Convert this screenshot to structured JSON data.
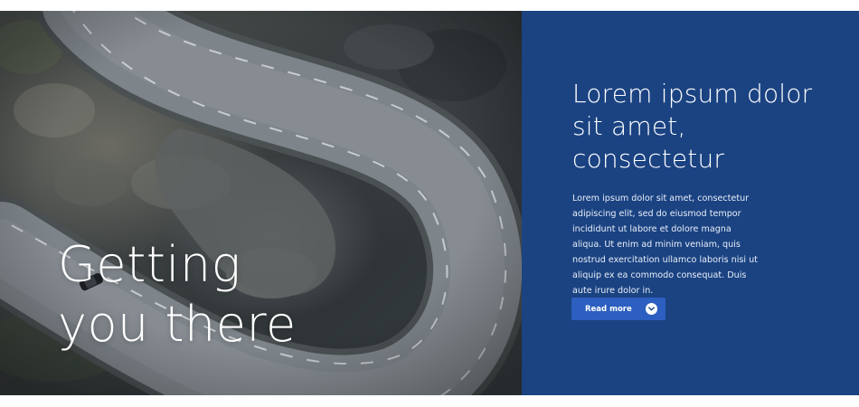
{
  "hero": {
    "title": "Getting\nyou there",
    "image_icon": "winding-mountain-road-photo"
  },
  "panel": {
    "heading": "Lorem ipsum dolor sit amet, consectetur",
    "body": "Lorem ipsum dolor sit amet, consectetur adipiscing elit, sed do eiusmod tempor incididunt ut labore et dolore magna aliqua. Ut enim ad minim veniam, quis nostrud exercitation ullamco laboris nisi ut aliquip ex ea commodo consequat. Duis aute irure dolor in.",
    "button_label": "Read more",
    "button_icon": "chevron-down-icon"
  },
  "colors": {
    "panel_background": "#1b4382",
    "button_background": "#2c5fbf",
    "text": "#ffffff"
  }
}
